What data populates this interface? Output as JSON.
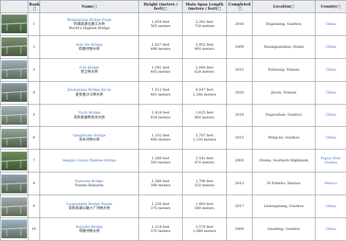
{
  "columns": [
    "",
    "Rank",
    "Name",
    "Height (meters / feet)",
    "Main Span Length (meters / feet)",
    "Completed",
    "Location",
    "Country"
  ],
  "rows": [
    {
      "rank": "1",
      "name_en": "Beipanjiang Bridge Duge",
      "name_zh": "杭瑞高速北盘江大桥",
      "name_extra": "World's Highest Bridge",
      "height_m": "565",
      "height_ft": "1,854",
      "span_m": "720",
      "span_ft": "2,362",
      "completed": "2016",
      "location": "Dugexiang, Guizhou",
      "country": "China",
      "img_top": "#6f8a6a",
      "img_bottom": "#3c5a3a"
    },
    {
      "rank": "2",
      "name_en": "Sidu He Bridge",
      "name_zh": "四渡河特大桥",
      "height_m": "496",
      "height_ft": "1,627",
      "span_m": "900",
      "span_ft": "2,952",
      "completed": "2009",
      "location": "Yesanguanzhen, Hubei",
      "country": "China",
      "img_top": "#7d8f6e",
      "img_bottom": "#4a5b40"
    },
    {
      "rank": "3",
      "name_en": "Puli Bridge",
      "name_zh": "普立特大桥",
      "height_m": "485",
      "height_ft": "1,591",
      "span_m": "628",
      "span_ft": "2,060",
      "completed": "2015",
      "location": "Pulixiang, Yunnan",
      "country": "China",
      "img_top": "#9fb0b9",
      "img_bottom": "#5b6b5f"
    },
    {
      "rank": "4",
      "name_en": "Jinshajiang Bridge Jin'an",
      "name_zh": "金安金沙江特大桥",
      "height_m": "461",
      "height_ft": "1,512",
      "span_m": "1,386",
      "span_ft": "4,547",
      "completed": "2020",
      "location": "Jin'an, Yunnan",
      "country": "China",
      "img_top": "#8c9aa5",
      "img_bottom": "#4e5c4a"
    },
    {
      "rank": "5",
      "name_en": "Yachi Bridge",
      "name_zh": "贵黔高速鸭池河大桥",
      "height_m": "434",
      "height_ft": "1,424",
      "span_m": "800",
      "span_ft": "2,625",
      "completed": "2016",
      "location": "Dagouzhen, Guizhou",
      "country": "China",
      "img_top": "#a7b6c2",
      "img_bottom": "#5e6e58"
    },
    {
      "rank": "6",
      "name_en": "Qingshuihe Bridge",
      "name_zh": "清水河特大桥",
      "height_m": "406",
      "height_ft": "1,332",
      "span_m": "1,130",
      "span_ft": "3,707",
      "completed": "2015",
      "location": "Weng'an, Guizhou",
      "country": "China",
      "img_top": "#95a69a",
      "img_bottom": "#4d5e47"
    },
    {
      "rank": "7",
      "name_en": "Hegigio Gorge Pipeline Bridge",
      "name_zh": "",
      "height_m": "393",
      "height_ft": "1,289",
      "span_m": "470",
      "span_ft": "1,542",
      "completed": "2005",
      "location": "Otoma, Southern Highlands",
      "country": "Papua New Guinea",
      "img_top": "#6d8d5a",
      "img_bottom": "#3e5a32"
    },
    {
      "rank": "8",
      "name_en": "Baluarte Bridge",
      "name_zh": "Puente Baluarte",
      "height_m": "390",
      "height_ft": "1,280",
      "span_m": "520",
      "span_ft": "1,706",
      "completed": "2013",
      "location": "El Palmito, Sinaloa",
      "country": "Mexico",
      "img_top": "#8fa2b4",
      "img_bottom": "#56664c"
    },
    {
      "rank": "9",
      "name_en": "Liuguanghe Bridge Xiqian",
      "name_zh": "贵黔高速公路六广河特大桥",
      "height_m": "375",
      "height_ft": "1,230",
      "span_m": "580",
      "span_ft": "1,903",
      "completed": "2017",
      "location": "Liutongxiang, Guizhou",
      "country": "China",
      "img_top": "#a3adb2",
      "img_bottom": "#5f6a58"
    },
    {
      "rank": "10",
      "name_en": "Baluohe Bridge",
      "name_zh": "坝陵河特大桥",
      "height_m": "370",
      "height_ft": "1,214",
      "span_m": "1,088",
      "span_ft": "3,570",
      "completed": "2009",
      "location": "Guanling, Guizhou",
      "country": "China",
      "img_top": "#9fb3c6",
      "img_bottom": "#607060"
    }
  ],
  "unit_feet": "feet",
  "unit_meters": "meters"
}
